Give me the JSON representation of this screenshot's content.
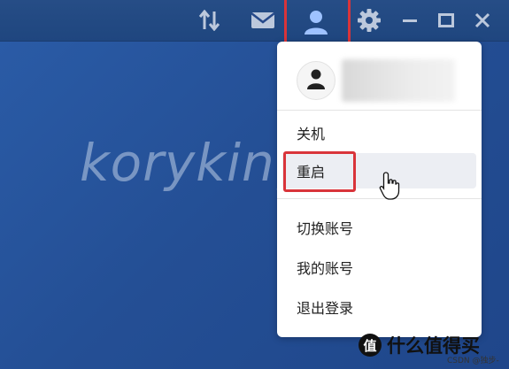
{
  "toolbar": {
    "icons": [
      "transfer-icon",
      "mail-icon",
      "user-icon",
      "gear-icon",
      "minimize-icon",
      "maximize-icon",
      "close-icon"
    ]
  },
  "watermark": "koryking",
  "menu": {
    "items": [
      {
        "label": "关机"
      },
      {
        "label": "重启"
      },
      {
        "label": "切换账号"
      },
      {
        "label": "我的账号"
      },
      {
        "label": "退出登录"
      }
    ]
  },
  "footer": {
    "brand_logo": "值",
    "brand_text": "什么值得买",
    "csdn_text": "CSDN @独步-"
  },
  "colors": {
    "highlight": "#d9343a",
    "desktop": "#2a5ba6",
    "active_icon": "#9ec2ff"
  }
}
